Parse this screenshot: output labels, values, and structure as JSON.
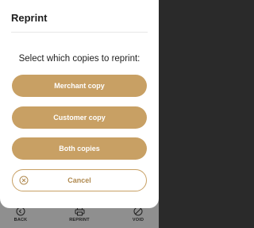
{
  "dialog": {
    "title": "Reprint",
    "prompt": "Select which copies to reprint:",
    "buttons": {
      "merchant_copy": "Merchant copy",
      "customer_copy": "Customer copy",
      "both_copies": "Both copies",
      "cancel": "Cancel"
    }
  },
  "bottom_nav": {
    "back": "BACK",
    "reprint": "REPRINT",
    "void": "VOID"
  },
  "colors": {
    "accent": "#c8a064",
    "overlay": "#8f8f8f",
    "dialog_bg": "#ffffff",
    "text": "#1e1e1e"
  },
  "icons": {
    "cancel": "cancel-circle-icon",
    "back": "back-circle-icon",
    "reprint": "printer-icon",
    "void": "void-circle-icon"
  }
}
